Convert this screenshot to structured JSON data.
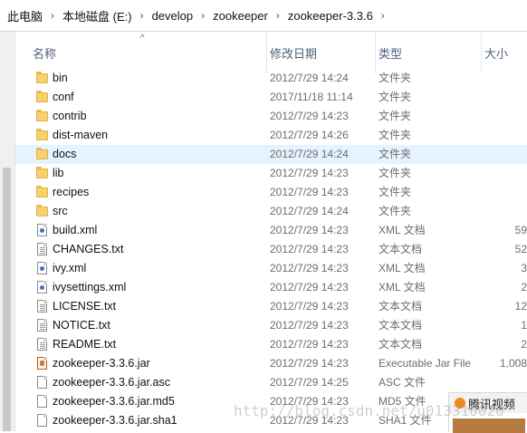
{
  "breadcrumb": [
    "此电脑",
    "本地磁盘 (E:)",
    "develop",
    "zookeeper",
    "zookeeper-3.3.6"
  ],
  "columns": {
    "name": "名称",
    "date": "修改日期",
    "type": "类型",
    "size": "大小"
  },
  "rows": [
    {
      "icon": "folder-icon",
      "name": "bin",
      "date": "2012/7/29 14:24",
      "type": "文件夹",
      "size": ""
    },
    {
      "icon": "folder-icon",
      "name": "conf",
      "date": "2017/11/18 11:14",
      "type": "文件夹",
      "size": ""
    },
    {
      "icon": "folder-icon",
      "name": "contrib",
      "date": "2012/7/29 14:23",
      "type": "文件夹",
      "size": ""
    },
    {
      "icon": "folder-icon",
      "name": "dist-maven",
      "date": "2012/7/29 14:26",
      "type": "文件夹",
      "size": ""
    },
    {
      "icon": "folder-icon",
      "name": "docs",
      "date": "2012/7/29 14:24",
      "type": "文件夹",
      "size": "",
      "selected": true
    },
    {
      "icon": "folder-icon",
      "name": "lib",
      "date": "2012/7/29 14:23",
      "type": "文件夹",
      "size": ""
    },
    {
      "icon": "folder-icon",
      "name": "recipes",
      "date": "2012/7/29 14:23",
      "type": "文件夹",
      "size": ""
    },
    {
      "icon": "folder-icon",
      "name": "src",
      "date": "2012/7/29 14:24",
      "type": "文件夹",
      "size": ""
    },
    {
      "icon": "xml-file-icon",
      "name": "build.xml",
      "date": "2012/7/29 14:23",
      "type": "XML 文档",
      "size": "59"
    },
    {
      "icon": "text-file-icon",
      "name": "CHANGES.txt",
      "date": "2012/7/29 14:23",
      "type": "文本文档",
      "size": "52"
    },
    {
      "icon": "xml-file-icon",
      "name": "ivy.xml",
      "date": "2012/7/29 14:23",
      "type": "XML 文档",
      "size": "3"
    },
    {
      "icon": "xml-file-icon",
      "name": "ivysettings.xml",
      "date": "2012/7/29 14:23",
      "type": "XML 文档",
      "size": "2"
    },
    {
      "icon": "text-file-icon",
      "name": "LICENSE.txt",
      "date": "2012/7/29 14:23",
      "type": "文本文档",
      "size": "12"
    },
    {
      "icon": "text-file-icon",
      "name": "NOTICE.txt",
      "date": "2012/7/29 14:23",
      "type": "文本文档",
      "size": "1"
    },
    {
      "icon": "text-file-icon",
      "name": "README.txt",
      "date": "2012/7/29 14:23",
      "type": "文本文档",
      "size": "2"
    },
    {
      "icon": "jar-file-icon",
      "name": "zookeeper-3.3.6.jar",
      "date": "2012/7/29 14:23",
      "type": "Executable Jar File",
      "size": "1,008"
    },
    {
      "icon": "file-icon",
      "name": "zookeeper-3.3.6.jar.asc",
      "date": "2012/7/29 14:25",
      "type": "ASC 文件",
      "size": ""
    },
    {
      "icon": "file-icon",
      "name": "zookeeper-3.3.6.jar.md5",
      "date": "2012/7/29 14:23",
      "type": "MD5 文件",
      "size": ""
    },
    {
      "icon": "file-icon",
      "name": "zookeeper-3.3.6.jar.sha1",
      "date": "2012/7/29 14:23",
      "type": "SHA1 文件",
      "size": ""
    }
  ],
  "popup": {
    "title": "腾讯视频"
  },
  "watermark": "http://blog.csdn.net/u013310020"
}
